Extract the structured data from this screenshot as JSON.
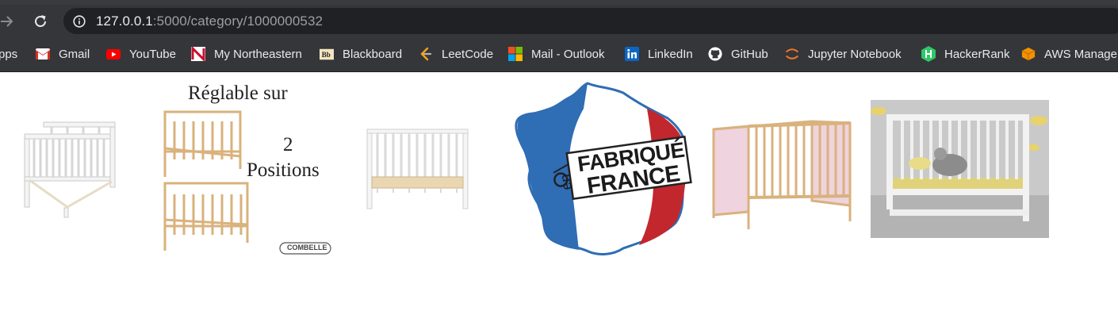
{
  "browser": {
    "url_host": "127.0.0.1",
    "url_path": ":5000/category/1000000532"
  },
  "bookmarks": [
    {
      "label": "pps",
      "icon": "apps-icon"
    },
    {
      "label": "Gmail",
      "icon": "gmail-icon"
    },
    {
      "label": "YouTube",
      "icon": "youtube-icon"
    },
    {
      "label": "My Northeastern",
      "icon": "northeastern-icon"
    },
    {
      "label": "Blackboard",
      "icon": "blackboard-icon"
    },
    {
      "label": "LeetCode",
      "icon": "leetcode-icon"
    },
    {
      "label": "Mail - Outlook",
      "icon": "microsoft-icon"
    },
    {
      "label": "LinkedIn",
      "icon": "linkedin-icon"
    },
    {
      "label": "GitHub",
      "icon": "github-icon"
    },
    {
      "label": "Jupyter Notebook",
      "icon": "jupyter-icon"
    },
    {
      "label": "HackerRank",
      "icon": "hackerrank-icon"
    },
    {
      "label": "AWS Managem",
      "icon": "aws-icon"
    }
  ],
  "products": [
    {
      "name": "white-crib"
    },
    {
      "name": "adjustable-pine-crib",
      "text": {
        "line1": "Réglable sur",
        "line2": "2",
        "line3": "Positions",
        "brand": "COMBELLE"
      }
    },
    {
      "name": "white-slatted-crib"
    },
    {
      "name": "fabrique-en-france",
      "text": {
        "line1": "FABRIQUÉ",
        "line2": "en",
        "line3": "FRANCE"
      }
    },
    {
      "name": "pink-panel-crib"
    },
    {
      "name": "grey-white-crib-photo"
    }
  ],
  "colors": {
    "chrome": "#35363a",
    "omnibox": "#202124",
    "france_blue": "#2f6db5",
    "france_red": "#c1272d",
    "pine": "#d9b27c"
  }
}
